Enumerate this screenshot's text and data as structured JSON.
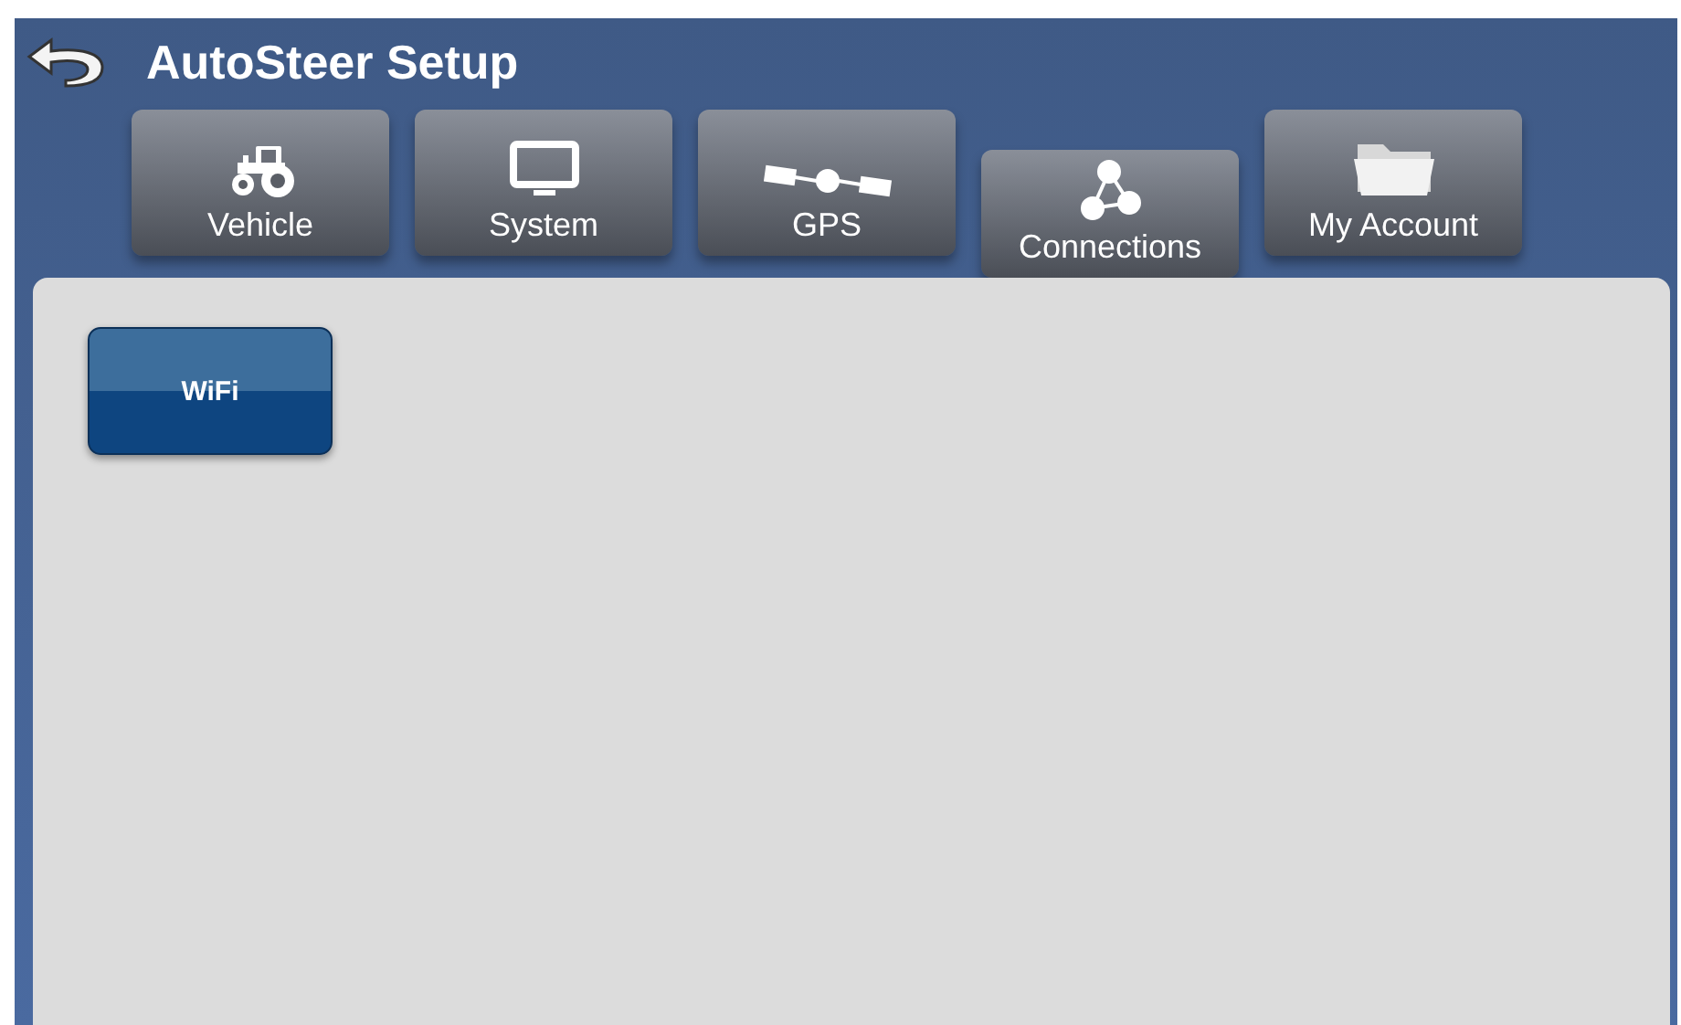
{
  "header": {
    "title": "AutoSteer Setup"
  },
  "tabs": [
    {
      "label": "Vehicle",
      "selected": false
    },
    {
      "label": "System",
      "selected": false
    },
    {
      "label": "GPS",
      "selected": false
    },
    {
      "label": "Connections",
      "selected": true
    },
    {
      "label": "My Account",
      "selected": false
    }
  ],
  "content": {
    "buttons": [
      "WiFi"
    ]
  }
}
